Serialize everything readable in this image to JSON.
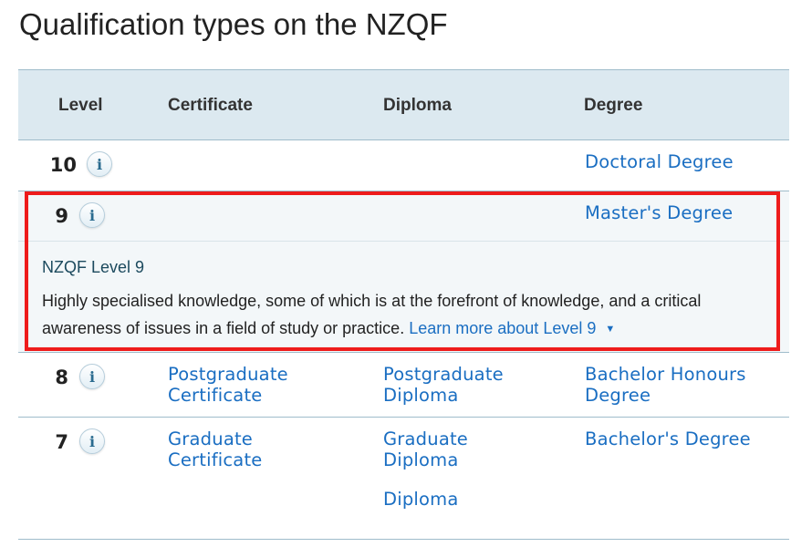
{
  "page": {
    "title": "Qualification types on the NZQF"
  },
  "table": {
    "headers": {
      "level": "Level",
      "certificate": "Certificate",
      "diploma": "Diploma",
      "degree": "Degree"
    },
    "info_icon_glyph": "i",
    "rows": [
      {
        "level": "10",
        "degree": "Doctoral Degree"
      },
      {
        "level": "9",
        "degree": "Master's Degree",
        "detail_heading": "NZQF Level 9",
        "detail_text": "Highly specialised knowledge, some of which is at the forefront of knowledge, and a critical awareness of issues in a field of study or practice.",
        "learn_more": "Learn more about Level 9",
        "caret": "▼"
      },
      {
        "level": "8",
        "certificate": "Postgraduate Certificate",
        "diploma": "Postgraduate Diploma",
        "degree": "Bachelor Honours Degree"
      },
      {
        "level": "7",
        "certificate": "Graduate Certificate",
        "diploma": [
          "Graduate Diploma",
          "Diploma"
        ],
        "degree": "Bachelor's Degree"
      }
    ]
  },
  "colors": {
    "header_bg": "#dce9f0",
    "link": "#1a6ec2",
    "highlight": "#ee1c1c",
    "border": "#9fbccb"
  }
}
